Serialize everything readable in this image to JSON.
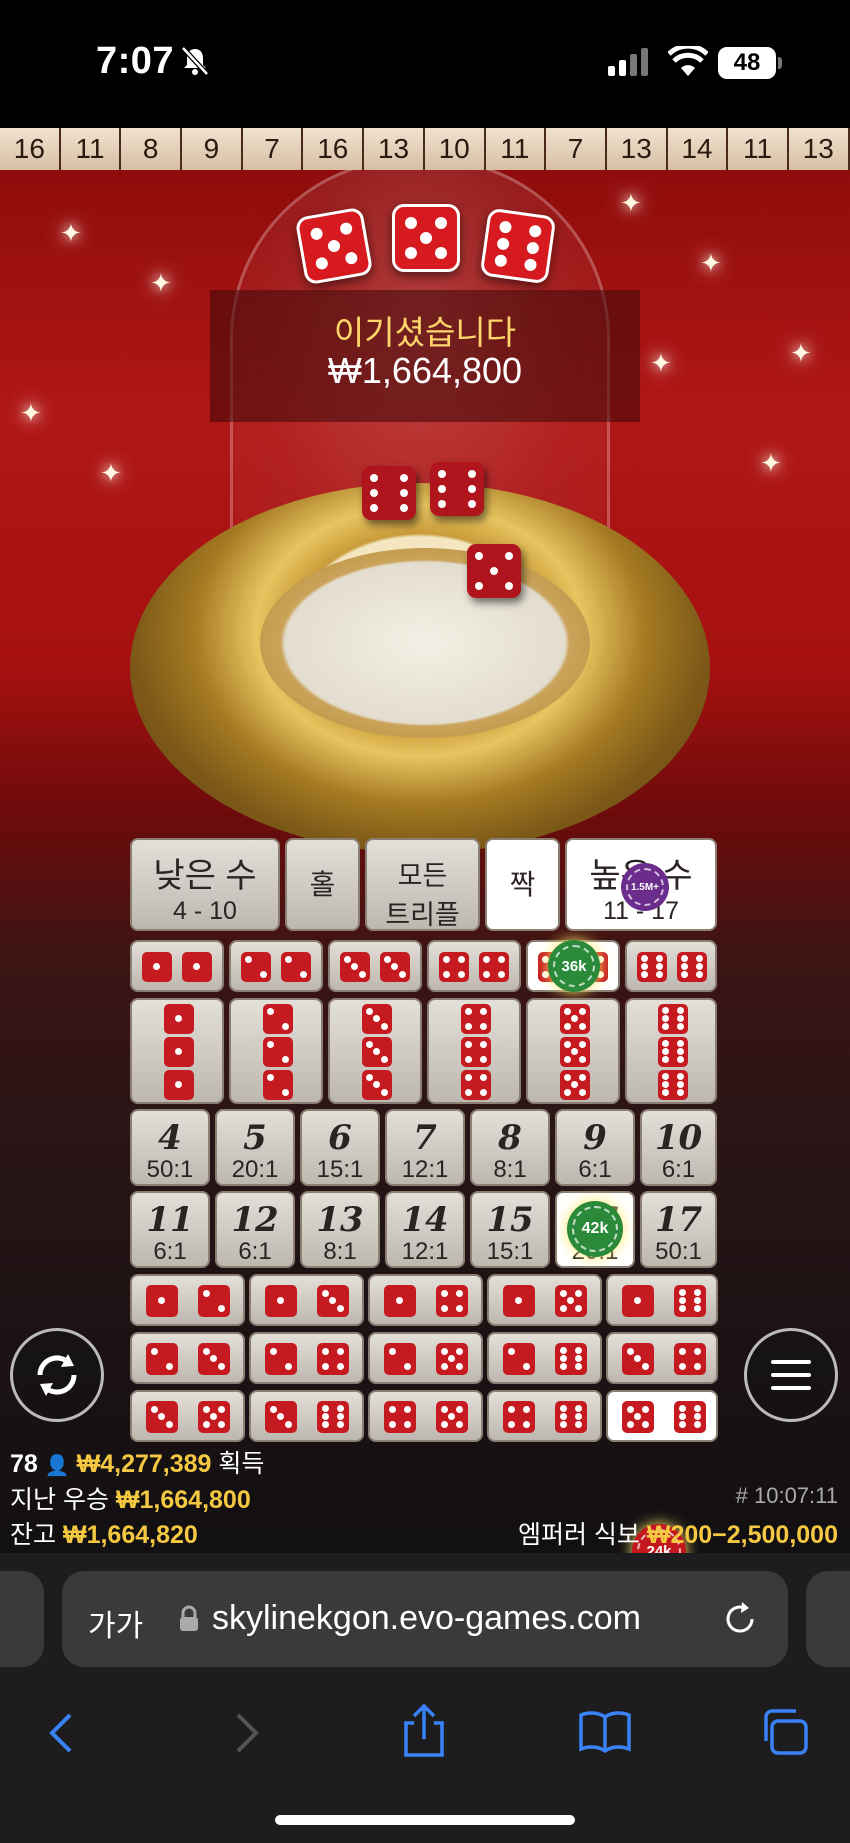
{
  "status_bar": {
    "time": "7:07",
    "battery": "48"
  },
  "history": [
    "16",
    "11",
    "8",
    "9",
    "7",
    "16",
    "13",
    "10",
    "11",
    "7",
    "13",
    "14",
    "11",
    "13"
  ],
  "result": {
    "title": "이기셨습니다",
    "amount": "₩1,664,800"
  },
  "board": {
    "low": {
      "label": "낮은 수",
      "range": "4 - 10"
    },
    "odd": "홀",
    "any_triple": {
      "line1": "모든",
      "line2": "트리플"
    },
    "even": "짝",
    "high": {
      "label": "높은 수",
      "range": "11 - 17"
    },
    "chips": {
      "high": "1.5M+",
      "double_5": "36k",
      "total_16": "42k",
      "combo_5_6": "24k"
    },
    "totals_row1": [
      {
        "num": "4",
        "odds": "50:1"
      },
      {
        "num": "5",
        "odds": "20:1"
      },
      {
        "num": "6",
        "odds": "15:1"
      },
      {
        "num": "7",
        "odds": "12:1"
      },
      {
        "num": "8",
        "odds": "8:1"
      },
      {
        "num": "9",
        "odds": "6:1"
      },
      {
        "num": "10",
        "odds": "6:1"
      }
    ],
    "totals_row2": [
      {
        "num": "11",
        "odds": "6:1"
      },
      {
        "num": "12",
        "odds": "6:1"
      },
      {
        "num": "13",
        "odds": "8:1"
      },
      {
        "num": "14",
        "odds": "12:1"
      },
      {
        "num": "15",
        "odds": "15:1"
      },
      {
        "num": "16",
        "odds": "20:1"
      },
      {
        "num": "17",
        "odds": "50:1"
      }
    ],
    "singles": [
      "하나",
      "둘",
      "셋",
      "넷",
      "다섯",
      "여섯"
    ]
  },
  "info": {
    "players": "78",
    "won_amount": "₩4,277,389",
    "won_label": "획득",
    "last_win_label": "지난 우승",
    "last_win": "₩1,664,800",
    "round_id": "# 10:07:11",
    "balance_label": "잔고",
    "balance": "₩1,664,820",
    "table_name": "엠퍼러 식보",
    "limits": "₩200−2,500,000"
  },
  "browser": {
    "aa": "가가",
    "url": "skylinekgon.evo-games.com"
  }
}
